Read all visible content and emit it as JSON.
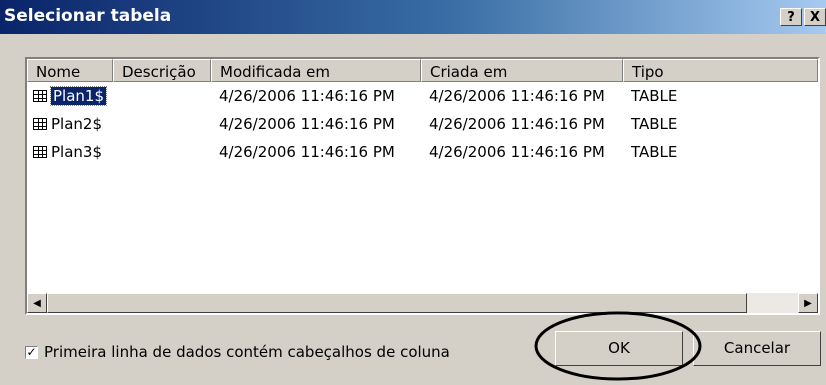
{
  "window": {
    "title": "Selecionar tabela",
    "help_label": "?",
    "close_label": "X"
  },
  "table": {
    "columns": [
      "Nome",
      "Descrição",
      "Modificada em",
      "Criada em",
      "Tipo"
    ],
    "rows": [
      {
        "name": "Plan1$",
        "description": "",
        "modified": "4/26/2006 11:46:16 PM",
        "created": "4/26/2006 11:46:16 PM",
        "type": "TABLE",
        "selected": true
      },
      {
        "name": "Plan2$",
        "description": "",
        "modified": "4/26/2006 11:46:16 PM",
        "created": "4/26/2006 11:46:16 PM",
        "type": "TABLE",
        "selected": false
      },
      {
        "name": "Plan3$",
        "description": "",
        "modified": "4/26/2006 11:46:16 PM",
        "created": "4/26/2006 11:46:16 PM",
        "type": "TABLE",
        "selected": false
      }
    ]
  },
  "scrollbar": {
    "left_arrow": "◀",
    "right_arrow": "▶"
  },
  "options": {
    "header_checkbox_label": "Primeira linha de dados contém cabeçalhos de coluna",
    "header_checkbox_checked": true,
    "check_mark": "✓"
  },
  "buttons": {
    "ok_label": "OK",
    "cancel_label": "Cancelar"
  },
  "annotation": {
    "ellipse_color": "#000000"
  }
}
